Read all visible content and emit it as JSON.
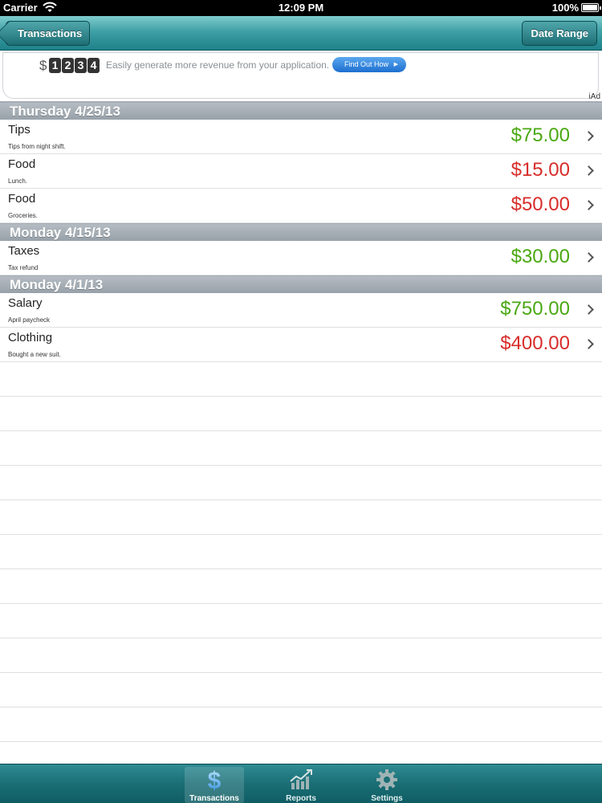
{
  "status": {
    "carrier": "Carrier",
    "time": "12:09 PM",
    "battery": "100%"
  },
  "nav": {
    "back": "Transactions",
    "range": "Date Range"
  },
  "ad": {
    "currency": "$",
    "digits": [
      "1",
      "2",
      "3",
      "4"
    ],
    "text": "Easily generate more revenue from your application.",
    "cta": "Find Out How",
    "badge": "iAd"
  },
  "sections": [
    {
      "header": "Thursday 4/25/13",
      "rows": [
        {
          "title": "Tips",
          "subtitle": "Tips from night shift.",
          "amount": "$75.00",
          "kind": "pos"
        },
        {
          "title": "Food",
          "subtitle": "Lunch.",
          "amount": "$15.00",
          "kind": "neg"
        },
        {
          "title": "Food",
          "subtitle": "Groceries.",
          "amount": "$50.00",
          "kind": "neg"
        }
      ]
    },
    {
      "header": "Monday 4/15/13",
      "rows": [
        {
          "title": "Taxes",
          "subtitle": "Tax refund",
          "amount": "$30.00",
          "kind": "pos"
        }
      ]
    },
    {
      "header": "Monday 4/1/13",
      "rows": [
        {
          "title": "Salary",
          "subtitle": "April paycheck",
          "amount": "$750.00",
          "kind": "pos"
        },
        {
          "title": "Clothing",
          "subtitle": "Bought a new suit.",
          "amount": "$400.00",
          "kind": "neg"
        }
      ]
    }
  ],
  "colors": {
    "income": "#4aa811",
    "expense": "#d72d2a",
    "accent": "#1e8189"
  },
  "tabs": [
    {
      "label": "Transactions",
      "icon": "dollar-icon",
      "active": true
    },
    {
      "label": "Reports",
      "icon": "chart-icon",
      "active": false
    },
    {
      "label": "Settings",
      "icon": "gear-icon",
      "active": false
    }
  ]
}
